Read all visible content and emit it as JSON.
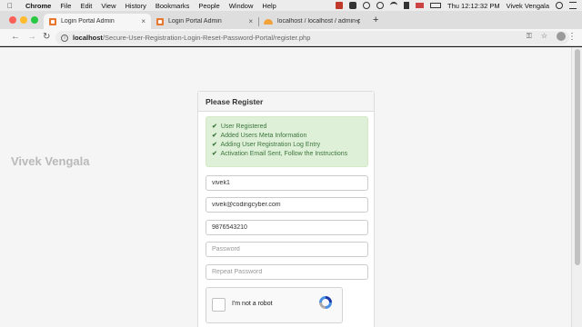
{
  "menubar": {
    "app_name": "Chrome",
    "menus": [
      "File",
      "Edit",
      "View",
      "History",
      "Bookmarks",
      "People",
      "Window",
      "Help"
    ],
    "clock": "Thu 12:12:32 PM",
    "user": "Vivek Vengala"
  },
  "tabs": [
    {
      "title": "Login Portal Admin"
    },
    {
      "title": "Login Portal Admin"
    },
    {
      "title": "localhost / localhost / admin-p"
    }
  ],
  "address_bar": {
    "host": "localhost",
    "path": "/Secure-User-Registration-Login-Reset-Password-Portal/register.php"
  },
  "page": {
    "watermark": "Vivek Vengala",
    "panel_title": "Please Register",
    "alert_lines": [
      "User Registered",
      "Added Users Meta Information",
      "Adding User Registration Log Entry",
      "Activation Email Sent, Follow the Instructions"
    ],
    "fields": {
      "username": {
        "value": "vivek1",
        "placeholder": ""
      },
      "email": {
        "value": "vivek@codingcyber.com",
        "placeholder": ""
      },
      "phone": {
        "value": "9876543210",
        "placeholder": ""
      },
      "password": {
        "value": "",
        "placeholder": "Password"
      },
      "repeat_password": {
        "value": "",
        "placeholder": "Repeat Password"
      }
    },
    "captcha_label": "I'm not a robot"
  },
  "colors": {
    "alert_bg": "#dff0d8",
    "alert_text": "#3c763d",
    "tab_favicon": "#e8772e"
  },
  "icons": {
    "check": "✔",
    "close": "×",
    "back": "←",
    "forward": "→",
    "reload": "↻",
    "new_tab": "+",
    "star": "☆",
    "kebab": "⋮"
  }
}
